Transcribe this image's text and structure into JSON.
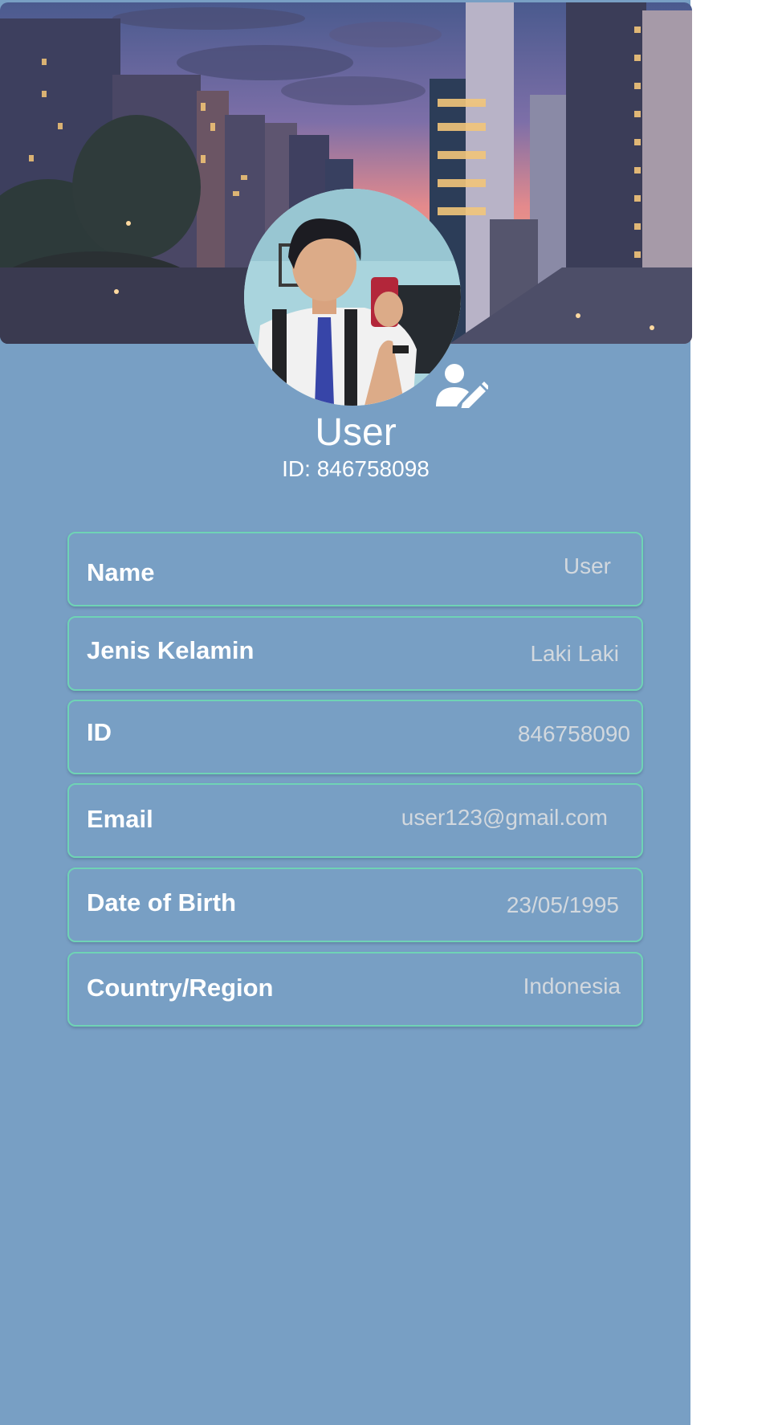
{
  "profile": {
    "display_name": "User",
    "id_text": "ID: 846758098"
  },
  "fields": {
    "name": {
      "label": "Name",
      "value": "User"
    },
    "gender": {
      "label": "Jenis Kelamin",
      "value": "Laki Laki"
    },
    "id": {
      "label": "ID",
      "value": "846758090"
    },
    "email": {
      "label": "Email",
      "value": "user123@gmail.com"
    },
    "dob": {
      "label": "Date of Birth",
      "value": "23/05/1995"
    },
    "country": {
      "label": "Country/Region",
      "value": "Indonesia"
    }
  },
  "icons": {
    "edit_profile": "user-edit-icon"
  },
  "colors": {
    "background": "#789fc4",
    "card_border": "#6fd3b5",
    "label_text": "#ffffff",
    "value_text": "#d2d8de"
  }
}
